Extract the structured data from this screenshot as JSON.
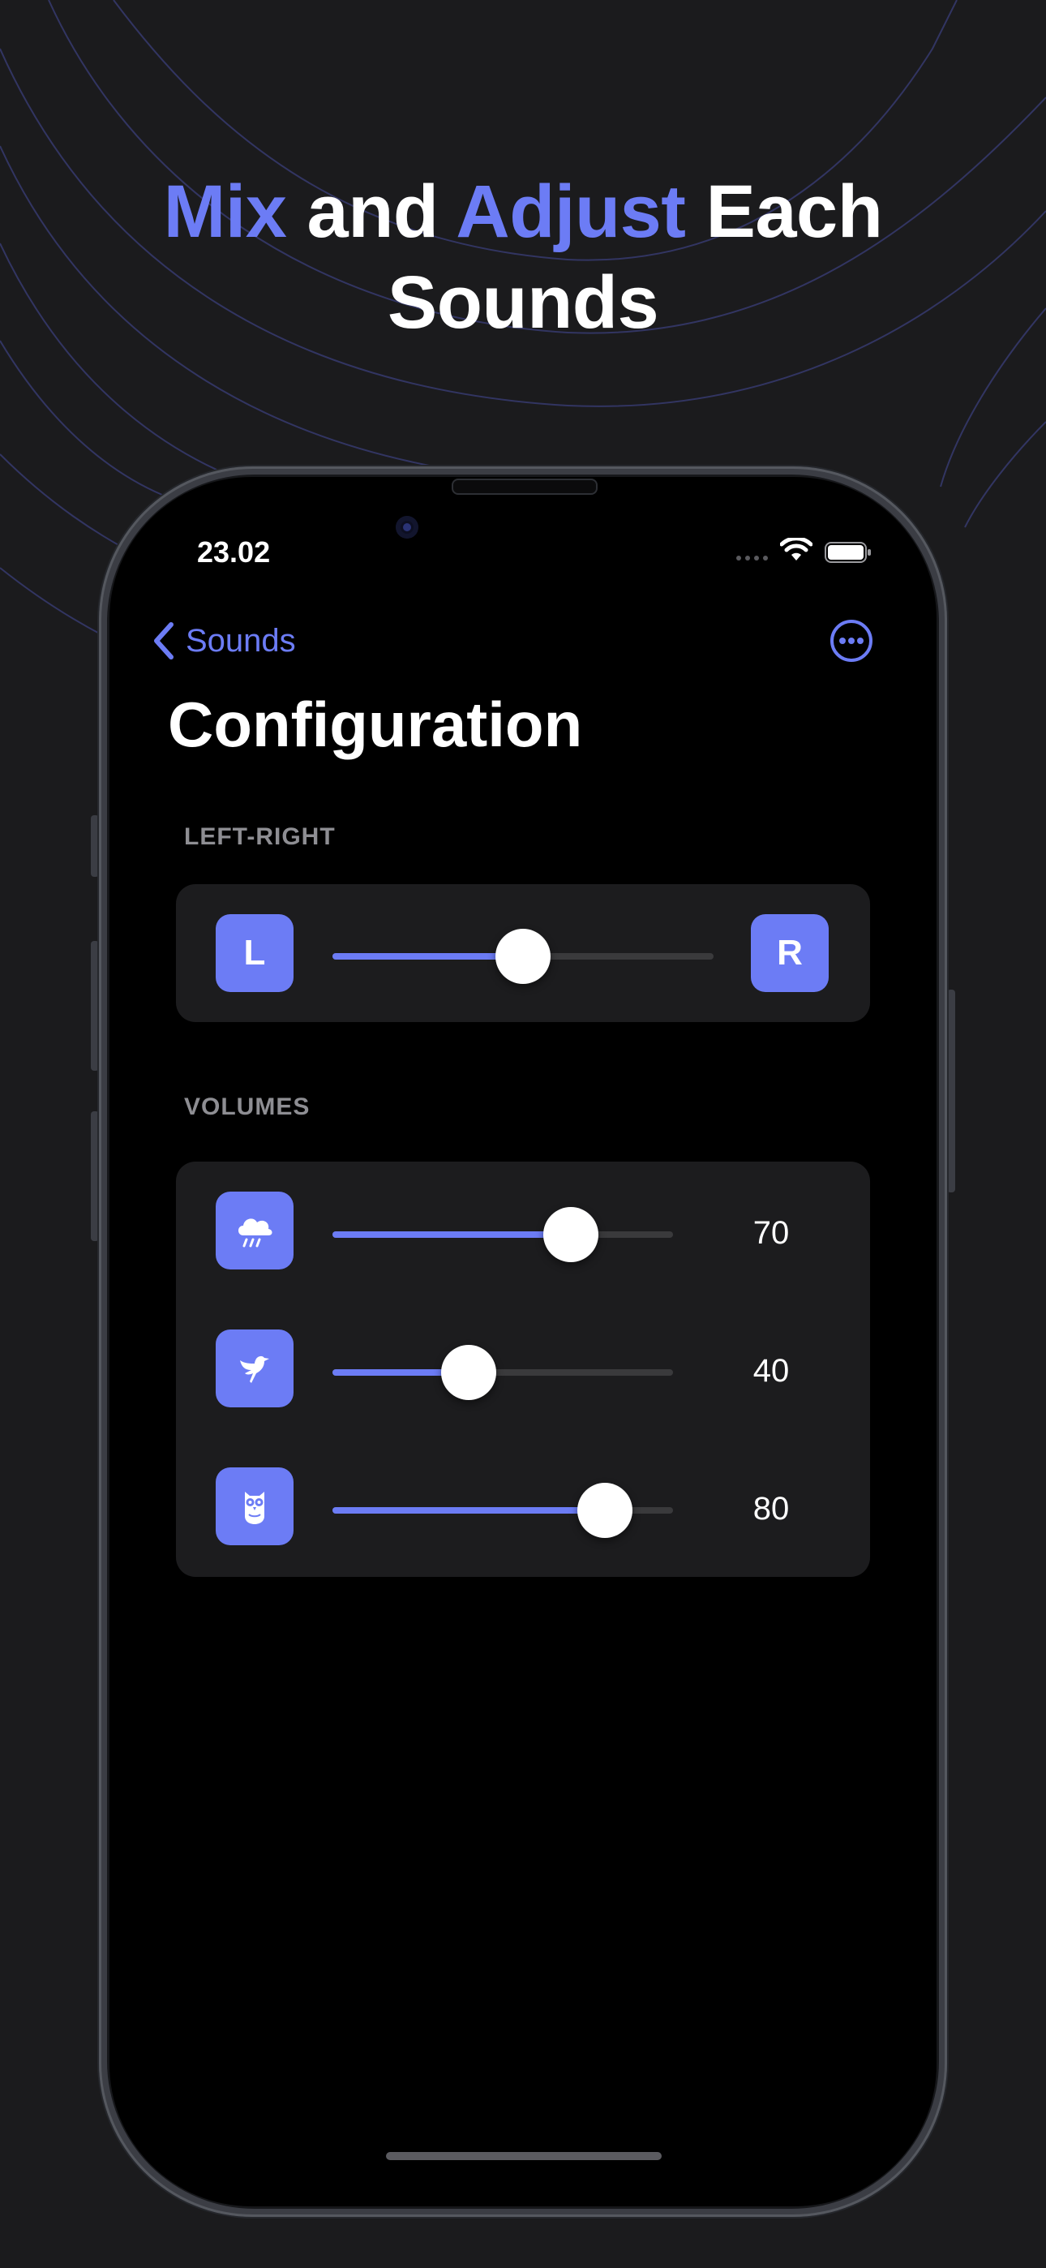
{
  "headline": {
    "part1": "Mix",
    "part2": " and ",
    "part3": "Adjust",
    "part4": " Each",
    "line2": "Sounds",
    "accent_color": "#6c7cf5"
  },
  "status_bar": {
    "time": "23.02",
    "icons": [
      "signal-icon",
      "wifi-icon",
      "battery-icon"
    ]
  },
  "nav": {
    "back_label": "Sounds",
    "back_icon": "chevron-left-icon",
    "more_icon": "ellipsis-circle-icon"
  },
  "page_title": "Configuration",
  "balance": {
    "section_label": "LEFT-RIGHT",
    "left_label": "L",
    "right_label": "R",
    "value": 0.5
  },
  "volumes": {
    "section_label": "VOLUMES",
    "items": [
      {
        "icon": "cloud-rain-icon",
        "value": 0.7,
        "value_label": "70"
      },
      {
        "icon": "bird-icon",
        "value": 0.4,
        "value_label": "40"
      },
      {
        "icon": "owl-icon",
        "value": 0.8,
        "value_label": "80"
      }
    ]
  }
}
